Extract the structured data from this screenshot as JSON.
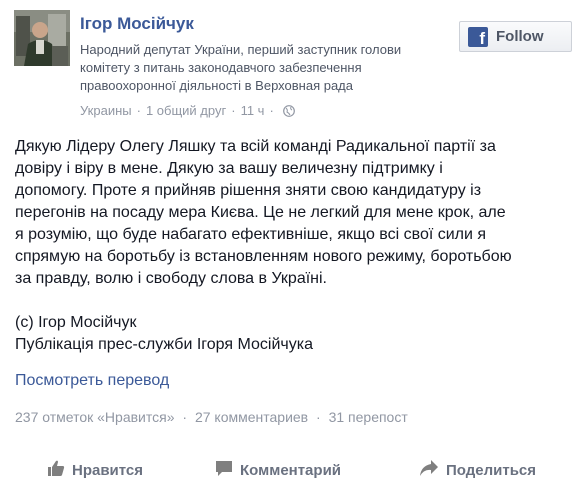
{
  "author": {
    "name": "Ігор Мосійчук",
    "bio_lines": [
      "Народний депутат України, перший заступник голови",
      "комітету з питань законодавчого забезпечення",
      "правоохоронної діяльності в Верховная рада"
    ],
    "location": "Украины",
    "mutual": "1 общий друг",
    "time": "11 ч"
  },
  "follow_label": "Follow",
  "fb_letter": "f",
  "post": {
    "lines": [
      "Дякую Лідеру Олегу Ляшку та всій команді Радикальної партії за",
      "довіру і віру в мене. Дякую за вашу величезну підтримку і",
      "допомогу. Проте я прийняв рішення зняти свою кандидатуру із",
      "перегонів на посаду мера Києва. Це не легкий для мене крок, але",
      "я розумію, що буде набагато ефективніше, якщо всі свої сили я",
      "спрямую на боротьбу із встановленням нового режиму, боротьбою",
      "за правду, волю і свободу слова в Україні."
    ],
    "signature": "(с) Ігор Мосійчук",
    "publication": "Публікація прес-служби Ігоря Мосійчука"
  },
  "translate_label": "Посмотреть перевод",
  "stats": {
    "likes": "237 отметок «Нравится»",
    "comments": "27 комментариев",
    "shares": "31 перепост",
    "separator": "·"
  },
  "actions": {
    "like": "Нравится",
    "comment": "Комментарий",
    "share": "Поделиться"
  },
  "colors": {
    "link": "#3b5998",
    "text": "#141823",
    "muted": "#9197a3",
    "action": "#6a7180"
  }
}
